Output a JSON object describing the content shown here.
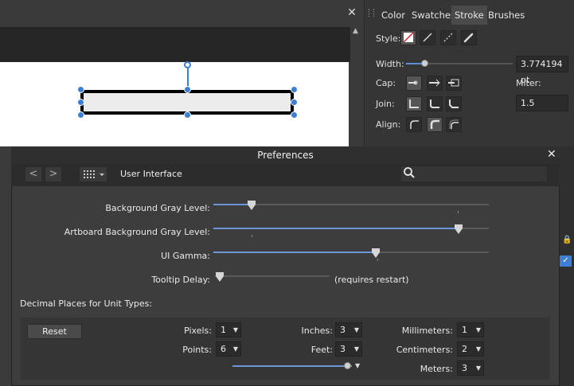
{
  "document": {
    "close_glyph": "✕"
  },
  "stroke_panel": {
    "tabs": [
      "Color",
      "Swatches",
      "Stroke",
      "Brushes"
    ],
    "active_tab": "Stroke",
    "style_label": "Style:",
    "width_label": "Width:",
    "width_value": "3.774194 pt",
    "width_fraction": 0.17,
    "cap_label": "Cap:",
    "miter_label": "Miter:",
    "join_label": "Join:",
    "miter_value": "1.5",
    "align_label": "Align:"
  },
  "preferences": {
    "title": "Preferences",
    "close_glyph": "✕",
    "back_glyph": "<",
    "forward_glyph": ">",
    "section": "User Interface",
    "search_placeholder": "",
    "sliders": [
      {
        "label": "Background Gray Level:",
        "value": 0.14
      },
      {
        "label": "Artboard Background Gray Level:",
        "value": 0.89
      },
      {
        "label": "UI Gamma:",
        "value": 0.59
      },
      {
        "label": "Tooltip Delay:",
        "value": 0.04,
        "note": "(requires restart)"
      }
    ],
    "decimal_label": "Decimal Places for Unit Types:",
    "reset_label": "Reset",
    "units": {
      "pixels": {
        "label": "Pixels:",
        "value": "1"
      },
      "points": {
        "label": "Points:",
        "value": "6"
      },
      "inches": {
        "label": "Inches:",
        "value": "3"
      },
      "feet": {
        "label": "Feet:",
        "value": "3"
      },
      "millimeters": {
        "label": "Millimeters:",
        "value": "1"
      },
      "centimeters": {
        "label": "Centimeters:",
        "value": "2"
      },
      "meters": {
        "label": "Meters:",
        "value": "3"
      }
    }
  }
}
